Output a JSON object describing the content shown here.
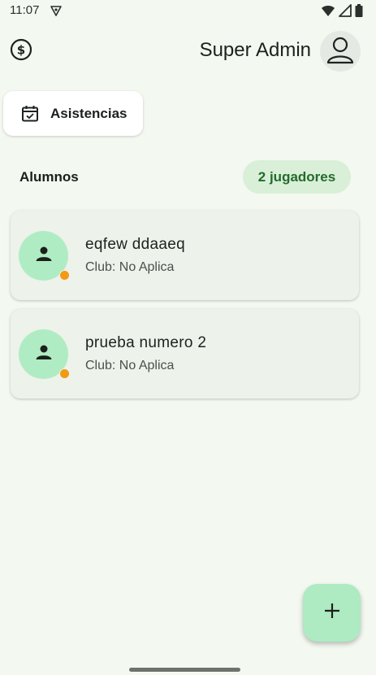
{
  "status_bar": {
    "time": "11:07",
    "icons": [
      "vpn-icon",
      "wifi-icon",
      "signal-icon",
      "battery-icon"
    ]
  },
  "header": {
    "currency_icon": "dollar-circle-icon",
    "user_name": "Super Admin",
    "avatar_icon": "person-outline-icon"
  },
  "actions": {
    "asistencias_label": "Asistencias",
    "asistencias_icon": "calendar-check-icon"
  },
  "section": {
    "title": "Alumnos",
    "count_badge": "2 jugadores"
  },
  "players": [
    {
      "name": "eqfew ddaaeq",
      "club": "Club: No Aplica",
      "status_color": "#f29a12"
    },
    {
      "name": "prueba numero 2",
      "club": "Club: No Aplica",
      "status_color": "#f29a12"
    }
  ],
  "fab": {
    "icon": "plus-icon",
    "label": "+"
  },
  "colors": {
    "background": "#f3f8f0",
    "card": "#edf2ea",
    "avatar_bg": "#b0ecc3",
    "badge_bg": "#d9efd8",
    "badge_text": "#256b2c",
    "status_dot": "#f29a12"
  }
}
